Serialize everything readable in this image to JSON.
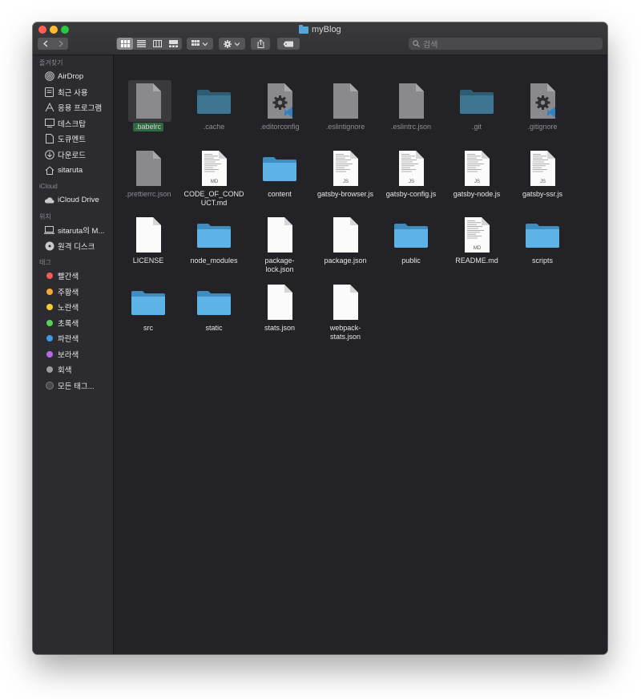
{
  "window": {
    "title": "myBlog"
  },
  "toolbar": {
    "search_placeholder": "검색"
  },
  "sidebar": {
    "sections": [
      {
        "title": "즐겨찾기",
        "items": [
          {
            "label": "AirDrop",
            "icon": "airdrop-icon"
          },
          {
            "label": "최근 사용",
            "icon": "recents-icon"
          },
          {
            "label": "응용 프로그램",
            "icon": "applications-icon"
          },
          {
            "label": "데스크탑",
            "icon": "desktop-icon"
          },
          {
            "label": "도큐멘트",
            "icon": "documents-icon"
          },
          {
            "label": "다운로드",
            "icon": "downloads-icon"
          },
          {
            "label": "sitaruta",
            "icon": "home-icon"
          }
        ]
      },
      {
        "title": "iCloud",
        "items": [
          {
            "label": "iCloud Drive",
            "icon": "cloud-icon"
          }
        ]
      },
      {
        "title": "위치",
        "items": [
          {
            "label": "sitaruta의 M...",
            "icon": "laptop-icon"
          },
          {
            "label": "원격 디스크",
            "icon": "disc-icon"
          }
        ]
      },
      {
        "title": "태그",
        "items": [
          {
            "label": "빨간색",
            "color": "#f25b57"
          },
          {
            "label": "주황색",
            "color": "#f7a633"
          },
          {
            "label": "노란색",
            "color": "#f3cc3a"
          },
          {
            "label": "초록색",
            "color": "#5ad05a"
          },
          {
            "label": "파란색",
            "color": "#3d9ae6"
          },
          {
            "label": "보라색",
            "color": "#b66be2"
          },
          {
            "label": "회색",
            "color": "#9b9ba0"
          },
          {
            "label": "모든 태그...",
            "color": "#4a4a4e"
          }
        ]
      }
    ]
  },
  "files": [
    {
      "name": ".babelrc",
      "type": "generic-dim",
      "selected": true
    },
    {
      "name": ".cache",
      "type": "folder-dim"
    },
    {
      "name": ".editorconfig",
      "type": "vscode-dim"
    },
    {
      "name": ".eslintignore",
      "type": "generic-dim"
    },
    {
      "name": ".eslintrc.json",
      "type": "generic-dim"
    },
    {
      "name": ".git",
      "type": "folder-dim"
    },
    {
      "name": ".gitignore",
      "type": "vscode-dim"
    },
    {
      "name": ".prettierrc.json",
      "type": "generic-dim"
    },
    {
      "name": "CODE_OF_COND UCT.md",
      "type": "md"
    },
    {
      "name": "content",
      "type": "folder"
    },
    {
      "name": "gatsby-browser.js",
      "type": "js"
    },
    {
      "name": "gatsby-config.js",
      "type": "js"
    },
    {
      "name": "gatsby-node.js",
      "type": "js"
    },
    {
      "name": "gatsby-ssr.js",
      "type": "js"
    },
    {
      "name": "LICENSE",
      "type": "blank"
    },
    {
      "name": "node_modules",
      "type": "folder"
    },
    {
      "name": "package- lock.json",
      "type": "blank"
    },
    {
      "name": "package.json",
      "type": "blank"
    },
    {
      "name": "public",
      "type": "folder"
    },
    {
      "name": "README.md",
      "type": "md"
    },
    {
      "name": "scripts",
      "type": "folder"
    },
    {
      "name": "src",
      "type": "folder"
    },
    {
      "name": "static",
      "type": "folder"
    },
    {
      "name": "stats.json",
      "type": "blank"
    },
    {
      "name": "webpack- stats.json",
      "type": "blank"
    }
  ],
  "badges": {
    "md": "MD",
    "js": "JS"
  }
}
